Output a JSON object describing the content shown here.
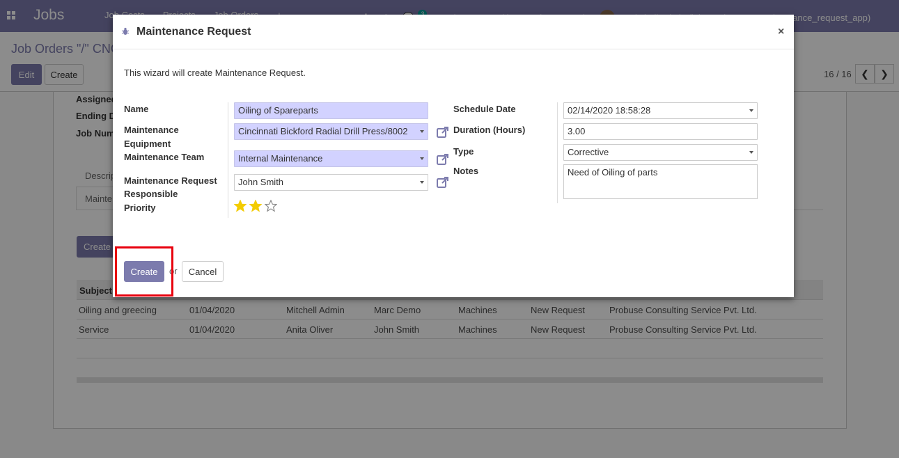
{
  "app": {
    "brand": "Jobs",
    "menu": [
      "Job Costs",
      "Projects",
      "Job Orders",
      "+"
    ],
    "company": "Probuse Consulting Service Pvt. Ltd.",
    "user": "Mitchell Admin (job_equipments_maintenance_request_app)",
    "message_count": "3",
    "colors": {
      "accent": "#7c7bad",
      "required_bg": "#d2d2ff",
      "star": "#f3cc00",
      "highlight": "#e8000d"
    }
  },
  "control_panel": {
    "breadcrumb": "Job Orders \"/\" CNC",
    "edit_label": "Edit",
    "create_label": "Create",
    "pager": "16 / 16"
  },
  "background_form": {
    "labels": [
      "Assigned",
      "Ending D",
      "Job Num"
    ],
    "tabs": [
      "Descrip",
      "Mainte"
    ],
    "create_button": "Create",
    "table": {
      "header": "Subject",
      "rows": [
        [
          "Oiling and greecing",
          "01/04/2020",
          "Mitchell Admin",
          "Marc Demo",
          "Machines",
          "New Request",
          "Probuse Consulting Service Pvt. Ltd."
        ],
        [
          "Service",
          "01/04/2020",
          "Anita Oliver",
          "John Smith",
          "Machines",
          "New Request",
          "Probuse Consulting Service Pvt. Ltd."
        ]
      ]
    }
  },
  "modal": {
    "title": "Maintenance Request",
    "title_icon": "bug-icon",
    "close_label": "×",
    "intro": "This wizard will create Maintenance Request.",
    "left": {
      "name_label": "Name",
      "name_value": "Oiling of Spareparts",
      "equipment_label_1": "Maintenance",
      "equipment_label_2": "Equipment",
      "equipment_value": "Cincinnati Bickford Radial Drill Press/8002",
      "team_label": "Maintenance Team",
      "team_value": "Internal Maintenance",
      "responsible_label_1": "Maintenance Request",
      "responsible_label_2": "Responsible",
      "responsible_value": "John Smith",
      "priority_label": "Priority",
      "priority_value": 2,
      "priority_max": 3
    },
    "right": {
      "schedule_label": "Schedule Date",
      "schedule_value": "02/14/2020 18:58:28",
      "duration_label": "Duration (Hours)",
      "duration_value": "3.00",
      "type_label": "Type",
      "type_value": "Corrective",
      "notes_label": "Notes",
      "notes_value": "Need of Oiling of parts"
    },
    "footer": {
      "create_label": "Create",
      "or_label": "or",
      "cancel_label": "Cancel"
    }
  }
}
